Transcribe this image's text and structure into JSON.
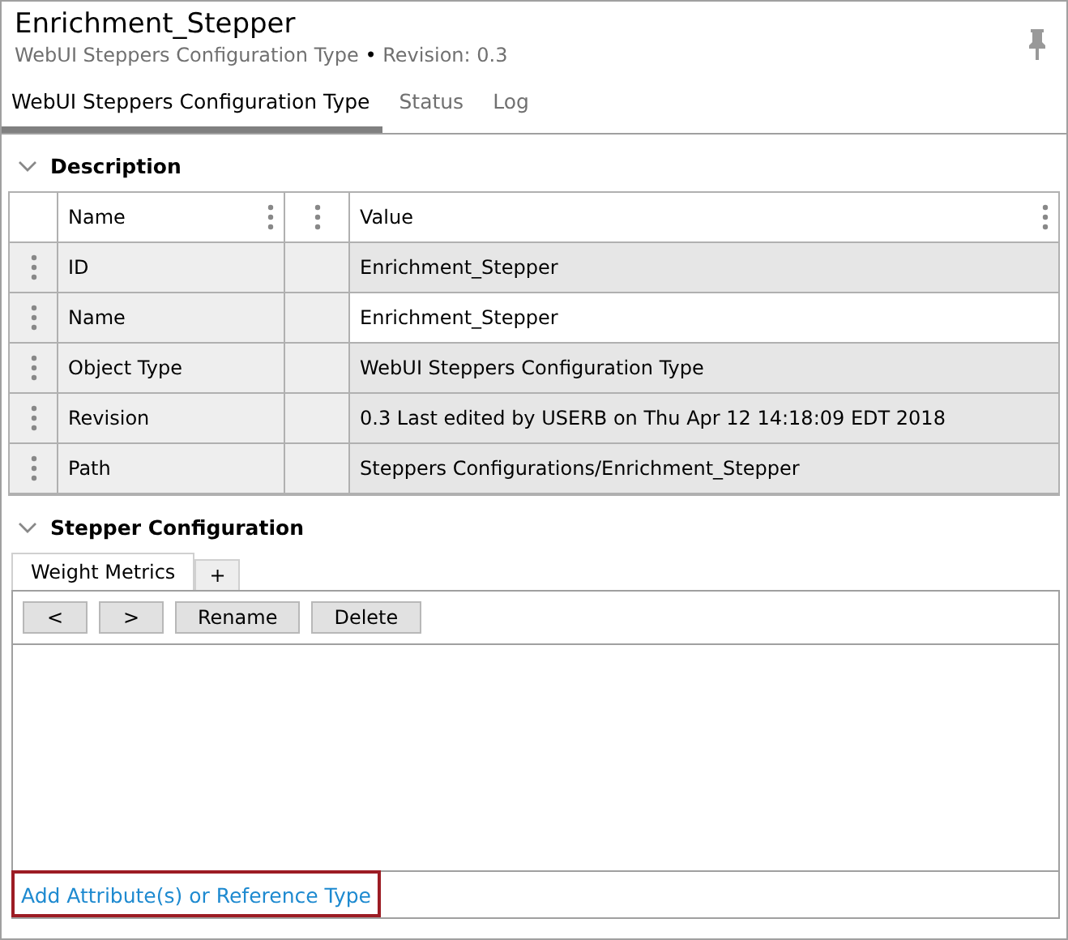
{
  "header": {
    "title": "Enrichment_Stepper",
    "subtitle": "WebUI Steppers Configuration Type",
    "separator": "•",
    "revision": "Revision: 0.3"
  },
  "tabs": [
    {
      "label": "WebUI Steppers Configuration Type",
      "selected": true
    },
    {
      "label": "Status",
      "selected": false
    },
    {
      "label": "Log",
      "selected": false
    }
  ],
  "description": {
    "title": "Description",
    "expanded": true,
    "columns": [
      "Name",
      "Value"
    ],
    "rows": [
      {
        "name": "ID",
        "value": "Enrichment_Stepper",
        "shaded": true
      },
      {
        "name": "Name",
        "value": "Enrichment_Stepper",
        "shaded": false
      },
      {
        "name": "Object Type",
        "value": "WebUI Steppers Configuration Type",
        "shaded": true
      },
      {
        "name": "Revision",
        "value": "0.3 Last edited by USERB on Thu Apr 12 14:18:09 EDT 2018",
        "shaded": true
      },
      {
        "name": "Path",
        "value": "Steppers Configurations/Enrichment_Stepper",
        "shaded": true
      }
    ]
  },
  "stepper_configuration": {
    "title": "Stepper Configuration",
    "expanded": true,
    "tabs": [
      {
        "label": "Weight Metrics",
        "selected": true
      },
      {
        "label": "+",
        "selected": false
      }
    ],
    "buttons": [
      "<",
      ">",
      "Rename",
      "Delete"
    ],
    "link": "Add Attribute(s) or Reference Type"
  }
}
